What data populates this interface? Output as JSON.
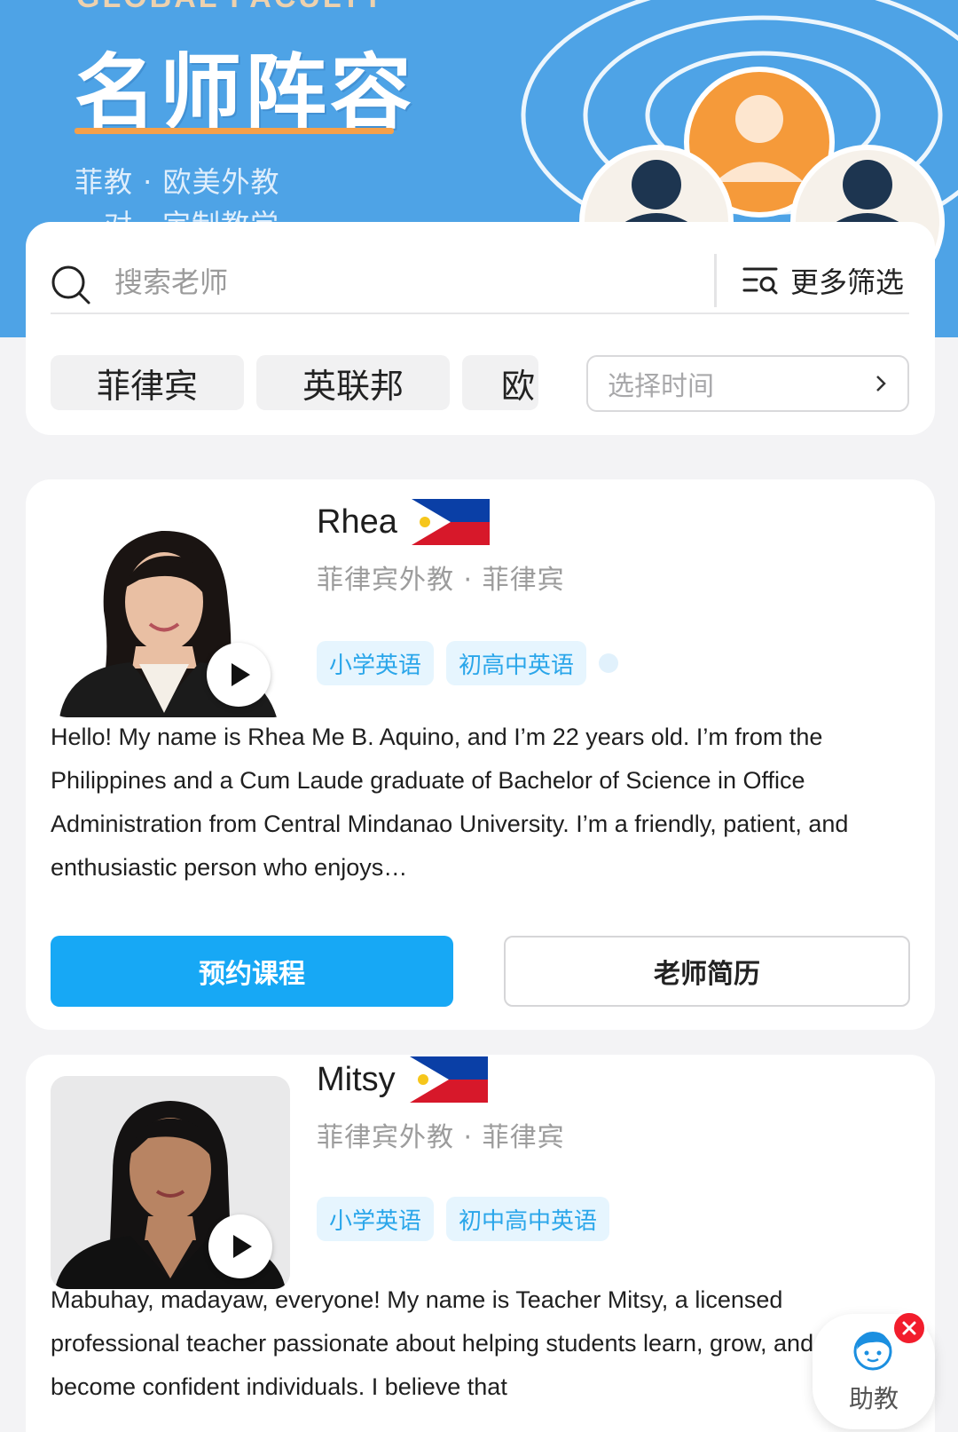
{
  "banner": {
    "faint_text": "GLOBAL FACULTY",
    "title": "名师阵容",
    "subtitle": "菲教 · 欧美外教",
    "subtitle2": "一对一定制教学",
    "colors": {
      "background": "#4ea3e6",
      "underline": "#f5a04a",
      "avatar_accent": "#f59a3a"
    }
  },
  "search": {
    "placeholder": "搜索老师",
    "icon": "search-icon",
    "more_filters_label": "更多筛选",
    "more_filters_icon": "filter-list-icon"
  },
  "chips": [
    {
      "label": "菲律宾"
    },
    {
      "label": "英联邦"
    },
    {
      "label": "欧"
    }
  ],
  "time_select": {
    "placeholder": "选择时间",
    "icon": "chevron-right-icon"
  },
  "teachers": [
    {
      "name": "Rhea",
      "flag": "philippines-flag",
      "meta": "菲律宾外教 · 菲律宾",
      "tags": [
        "小学英语",
        "初高中英语"
      ],
      "bio": "Hello! My name is Rhea Me B. Aquino, and I’m 22 years old. I’m from the Philippines and a Cum Laude graduate of Bachelor of Science in Office Administration from Central Mindanao University. I’m a friendly, patient, and enthusiastic person who enjoys…",
      "book_label": "预约课程",
      "profile_label": "老师简历"
    },
    {
      "name": "Mitsy",
      "flag": "philippines-flag",
      "meta": "菲律宾外教 · 菲律宾",
      "tags": [
        "小学英语",
        "初中高中英语"
      ],
      "bio": "Mabuhay, madayaw, everyone! My name is Teacher Mitsy, a licensed professional teacher passionate about helping students learn, grow, and become confident individuals. I believe that"
    }
  ],
  "assistant": {
    "label": "助教",
    "icon": "assistant-avatar-icon",
    "close_icon": "close-icon"
  },
  "colors": {
    "primary": "#17a8f5",
    "tag_bg": "#e6f5fe",
    "tag_text": "#2aa6ea",
    "close": "#f21d2c"
  }
}
